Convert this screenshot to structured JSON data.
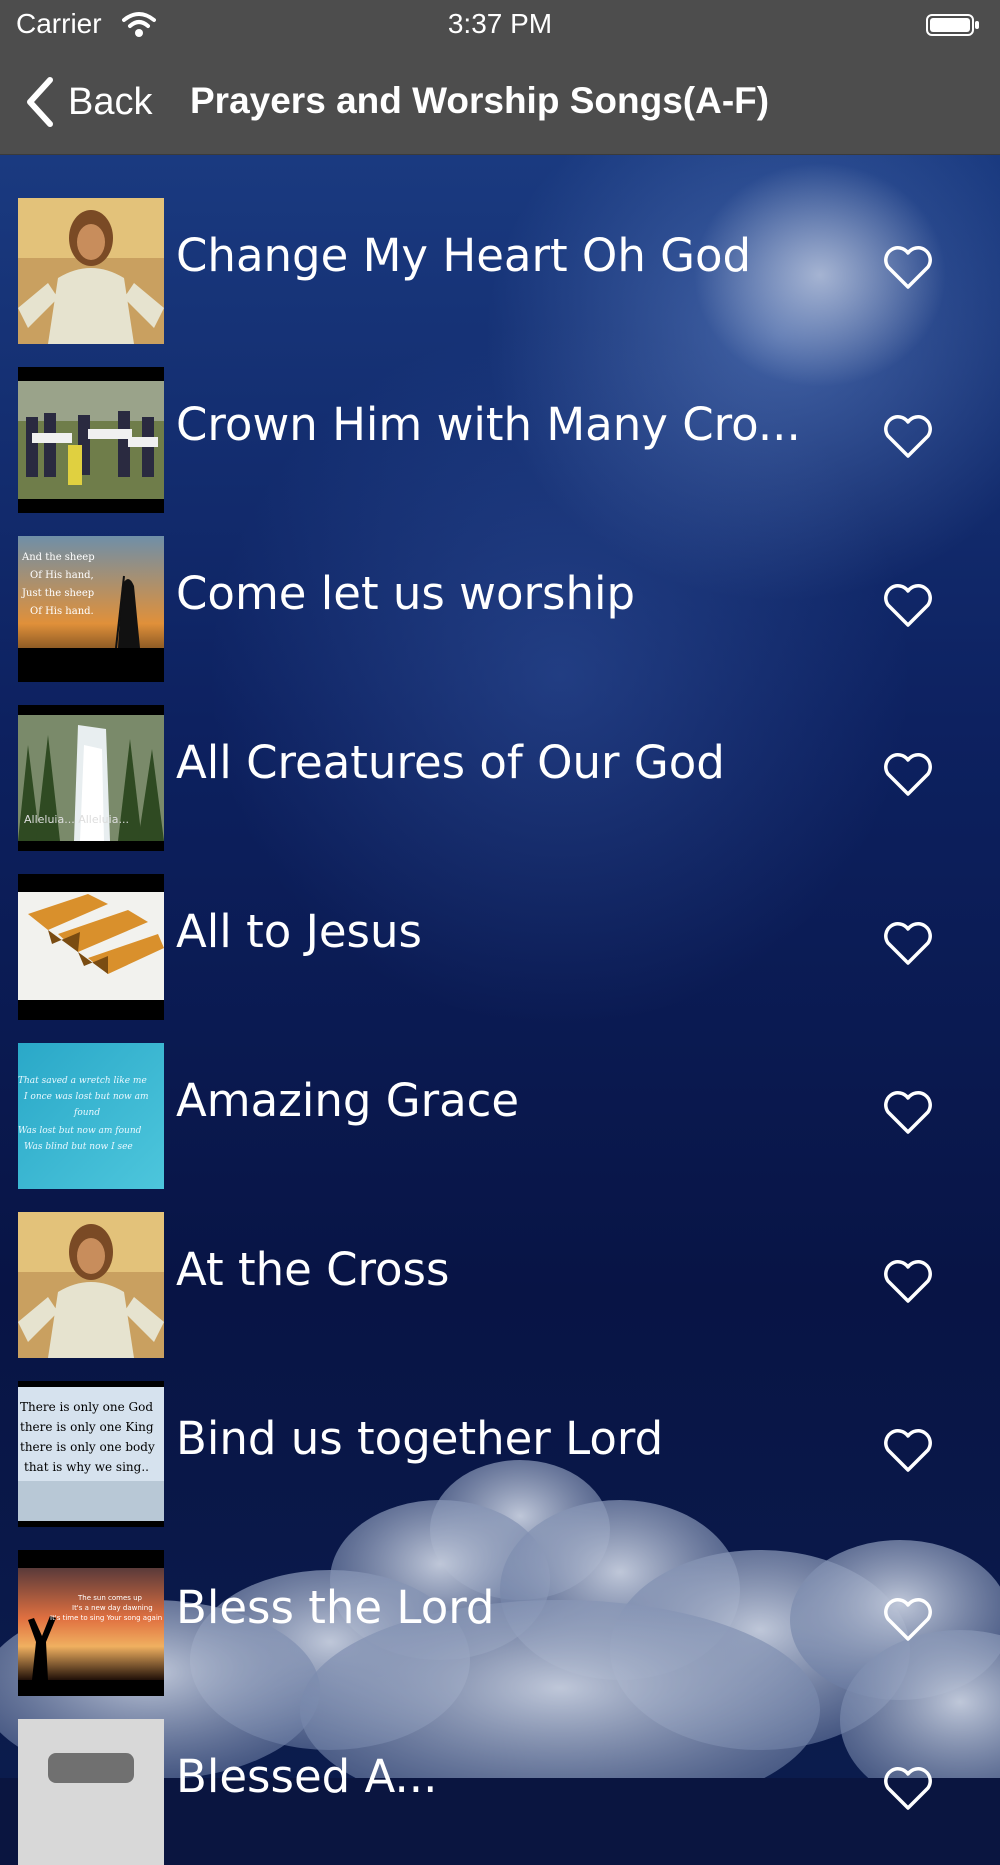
{
  "status_bar": {
    "carrier": "Carrier",
    "time": "3:37 PM"
  },
  "nav": {
    "back_label": "Back",
    "title": "Prayers and Worship Songs(A-F)"
  },
  "songs": [
    {
      "title": "Change My Heart Oh God"
    },
    {
      "title": "Crown Him with Many Cro..."
    },
    {
      "title": "Come let us worship"
    },
    {
      "title": "All Creatures of Our God"
    },
    {
      "title": "All to Jesus"
    },
    {
      "title": "Amazing Grace"
    },
    {
      "title": "At the Cross"
    },
    {
      "title": "Bind us together Lord"
    },
    {
      "title": "Bless the Lord"
    },
    {
      "title": "Blessed A..."
    }
  ],
  "thumb_text": {
    "come_let": [
      "And the sheep",
      "Of His hand,",
      "Just the sheep",
      "Of His hand."
    ],
    "all_creatures": "Alleluia... Alleluia...",
    "amazing_grace": [
      "That saved a wretch like me",
      "I once was lost but now am",
      "found",
      "Was lost but now am found",
      "Was blind but now I see"
    ],
    "bind_us": [
      "There is only one God",
      "there is only one King",
      "there is only one body",
      "that is why we sing.."
    ],
    "bless_lord": [
      "The sun comes up",
      "It's a new day dawning",
      "It's time to sing Your song again"
    ]
  },
  "colors": {
    "nav_background": "#4d4d4d",
    "text": "#ffffff",
    "background_top": "#1a3a80",
    "background_bottom": "#081445"
  },
  "icons": [
    "wifi-icon",
    "battery-icon",
    "chevron-left-icon",
    "heart-icon"
  ]
}
